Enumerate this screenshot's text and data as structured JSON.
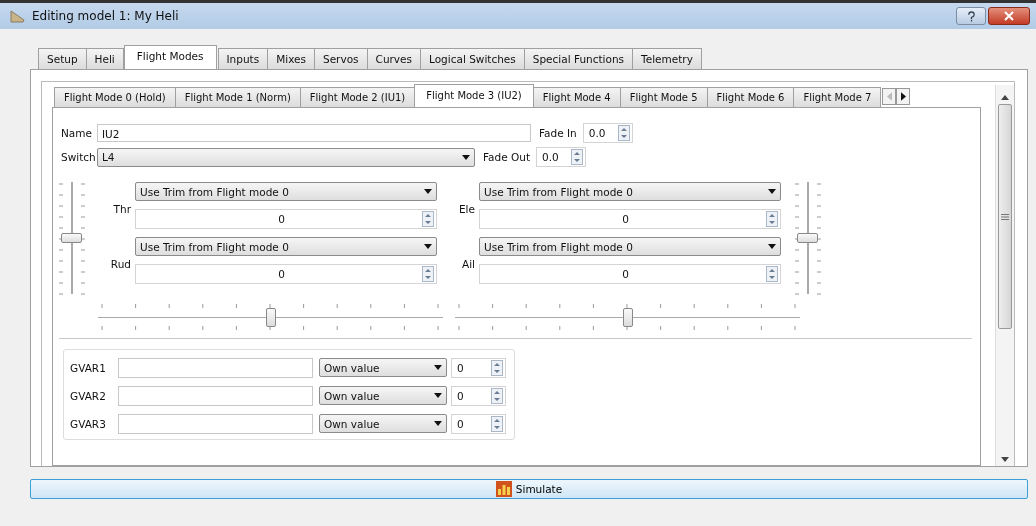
{
  "window": {
    "title": "Editing model 1: My Heli"
  },
  "tabs": [
    {
      "label": "Setup",
      "selected": false
    },
    {
      "label": "Heli",
      "selected": false
    },
    {
      "label": "Flight Modes",
      "selected": true
    },
    {
      "label": "Inputs",
      "selected": false
    },
    {
      "label": "Mixes",
      "selected": false
    },
    {
      "label": "Servos",
      "selected": false
    },
    {
      "label": "Curves",
      "selected": false
    },
    {
      "label": "Logical Switches",
      "selected": false
    },
    {
      "label": "Special Functions",
      "selected": false
    },
    {
      "label": "Telemetry",
      "selected": false
    }
  ],
  "flight_mode_tabs": [
    {
      "label": "Flight Mode 0 (Hold)",
      "selected": false
    },
    {
      "label": "Flight Mode 1 (Norm)",
      "selected": false
    },
    {
      "label": "Flight Mode 2 (IU1)",
      "selected": false
    },
    {
      "label": "Flight Mode 3 (IU2)",
      "selected": true
    },
    {
      "label": "Flight Mode 4",
      "selected": false
    },
    {
      "label": "Flight Mode 5",
      "selected": false
    },
    {
      "label": "Flight Mode 6",
      "selected": false
    },
    {
      "label": "Flight Mode 7",
      "selected": false
    }
  ],
  "tab_scroll": {
    "left_disabled": true,
    "right_disabled": false
  },
  "name": {
    "label": "Name",
    "value": "IU2"
  },
  "fade_in": {
    "label": "Fade In",
    "value": "0.0"
  },
  "switch": {
    "label": "Switch",
    "value": "L4"
  },
  "fade_out": {
    "label": "Fade Out",
    "value": "0.0"
  },
  "trims": [
    {
      "label": "Thr",
      "mode": "Use Trim from Flight mode 0",
      "value": "0"
    },
    {
      "label": "Rud",
      "mode": "Use Trim from Flight mode 0",
      "value": "0"
    },
    {
      "label": "Ele",
      "mode": "Use Trim from Flight mode 0",
      "value": "0"
    },
    {
      "label": "Ail",
      "mode": "Use Trim from Flight mode 0",
      "value": "0"
    }
  ],
  "sliders": [
    {
      "kind": "vertical",
      "level": 0.5
    },
    {
      "kind": "horizontal",
      "level": 0.5
    },
    {
      "kind": "horizontal",
      "level": 0.5
    },
    {
      "kind": "vertical",
      "level": 0.5
    }
  ],
  "gvars": [
    {
      "label": "GVAR1",
      "mode": "Own value",
      "value": "0"
    },
    {
      "label": "GVAR2",
      "mode": "Own value",
      "value": "0"
    },
    {
      "label": "GVAR3",
      "mode": "Own value",
      "value": "0"
    }
  ],
  "simulate_button": {
    "label": "Simulate"
  }
}
